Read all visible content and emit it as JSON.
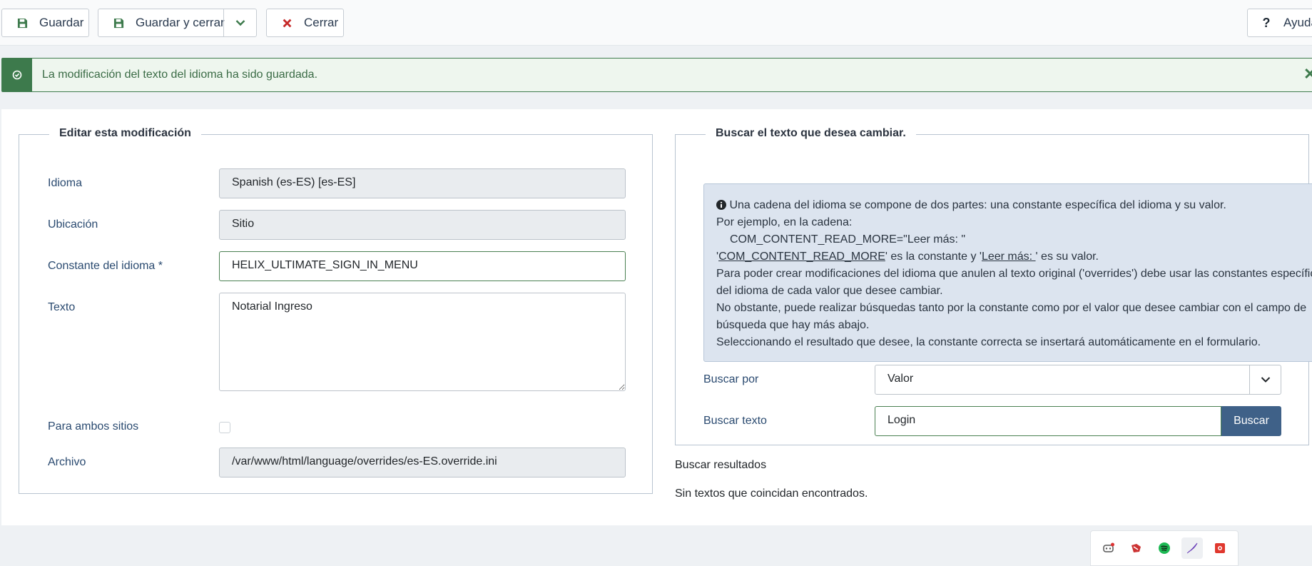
{
  "toolbar": {
    "save_label": "Guardar",
    "save_close_label": "Guardar y cerrar",
    "close_label": "Cerrar",
    "help_label": "Ayuda"
  },
  "alert": {
    "message": "La modificación del texto del idioma ha sido guardada."
  },
  "edit": {
    "legend": "Editar esta modificación",
    "language_label": "Idioma",
    "language_value": "Spanish (es-ES) [es-ES]",
    "location_label": "Ubicación",
    "location_value": "Sitio",
    "constant_label": "Constante del idioma *",
    "constant_value": "HELIX_ULTIMATE_SIGN_IN_MENU",
    "text_label": "Texto",
    "text_value": "Notarial Ingreso",
    "both_label": "Para ambos sitios",
    "file_label": "Archivo",
    "file_value": "/var/www/html/language/overrides/es-ES.override.ini"
  },
  "search": {
    "legend": "Buscar el texto que desea cambiar.",
    "info_line1": " Una cadena del idioma se compone de dos partes: una constante específica del idioma y su valor.",
    "info_line2": "Por ejemplo, en la cadena:",
    "info_line3": "COM_CONTENT_READ_MORE=\"Leer más: \"",
    "info_line4_pre": "'",
    "info_line4_const": "COM_CONTENT_READ_MORE",
    "info_line4_mid": "' es la constante y '",
    "info_line4_val": "Leer más: ",
    "info_line4_post": "' es su valor.",
    "info_line5": "Para poder crear modificaciones del idioma que anulen al texto original ('overrides') debe usar las constantes específicas del idioma de cada valor que desee cambiar.",
    "info_line6": "No obstante, puede realizar búsquedas tanto por la constante como por el valor que desee cambiar con el campo de búsqueda que hay más abajo.",
    "info_line7": "Seleccionando el resultado que desee, la constante correcta se insertará automáticamente en el formulario.",
    "search_by_label": "Buscar por",
    "search_by_value": "Valor",
    "search_text_label": "Buscar texto",
    "search_text_value": "Login",
    "search_button": "Buscar",
    "results_label": "Buscar resultados",
    "no_results": "Sin textos que coincidan encontrados."
  },
  "colors": {
    "success": "#3d7a4c",
    "primary": "#3f6188",
    "danger": "#c52827"
  }
}
